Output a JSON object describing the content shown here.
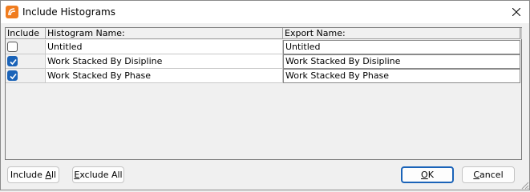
{
  "window": {
    "title": "Include Histograms",
    "close_glyph": "close-icon",
    "app_icon": "app-logo-icon"
  },
  "grid": {
    "columns": [
      "Include",
      "Histogram Name:",
      "Export Name:"
    ],
    "rows": [
      {
        "include": false,
        "name": "Untitled",
        "export": "Untitled"
      },
      {
        "include": true,
        "name": "Work Stacked By Disipline",
        "export": "Work Stacked By Disipline"
      },
      {
        "include": true,
        "name": "Work Stacked By Phase",
        "export": "Work Stacked By Phase"
      }
    ]
  },
  "buttons": {
    "include_all_pre": "Include ",
    "include_all_u": "A",
    "include_all_post": "ll",
    "exclude_all_pre": "",
    "exclude_all_u": "E",
    "exclude_all_post": "xclude All",
    "ok_pre": "",
    "ok_u": "O",
    "ok_post": "K",
    "cancel_pre": "",
    "cancel_u": "C",
    "cancel_post": "ancel"
  },
  "colors": {
    "accent": "#1a63b8",
    "app_icon": "#f07c1e"
  }
}
